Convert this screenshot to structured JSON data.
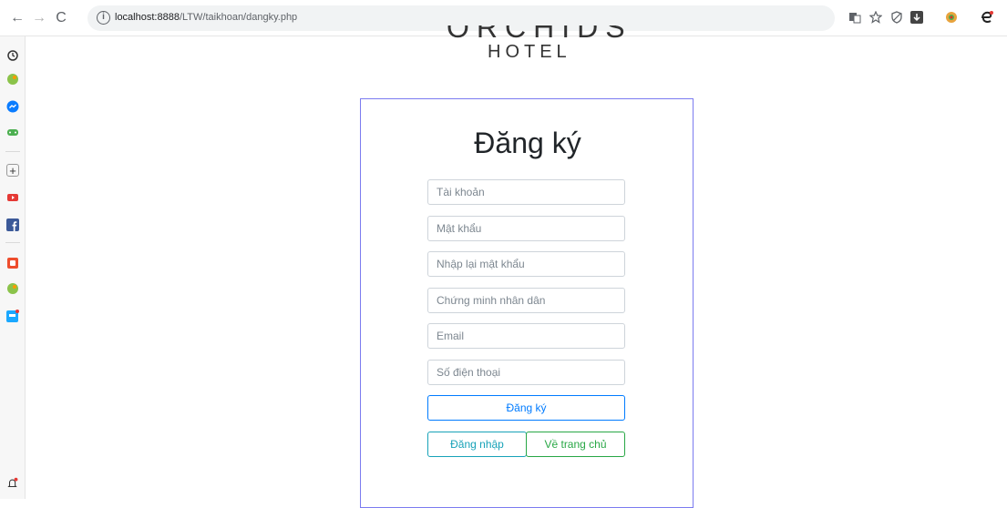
{
  "browser": {
    "url_host": "localhost:8888",
    "url_path": "/LTW/taikhoan/dangky.php"
  },
  "colors": {
    "card_border": "#7b7bf0",
    "primary": "#007bff",
    "info": "#17a2b8",
    "success": "#28a745"
  },
  "brand": {
    "top_text": "ORCHIDS",
    "subtitle": "HOTEL"
  },
  "form": {
    "title": "Đăng ký",
    "fields": [
      {
        "name": "username",
        "placeholder": "Tài khoản"
      },
      {
        "name": "password",
        "placeholder": "Mật khẩu"
      },
      {
        "name": "confirm_password",
        "placeholder": "Nhập lại mật khẩu"
      },
      {
        "name": "id_card",
        "placeholder": "Chứng minh nhân dân"
      },
      {
        "name": "email",
        "placeholder": "Email"
      },
      {
        "name": "phone",
        "placeholder": "Số điện thoại"
      }
    ],
    "register_label": "Đăng ký",
    "login_label": "Đăng nhập",
    "home_label": "Về trang chủ"
  }
}
